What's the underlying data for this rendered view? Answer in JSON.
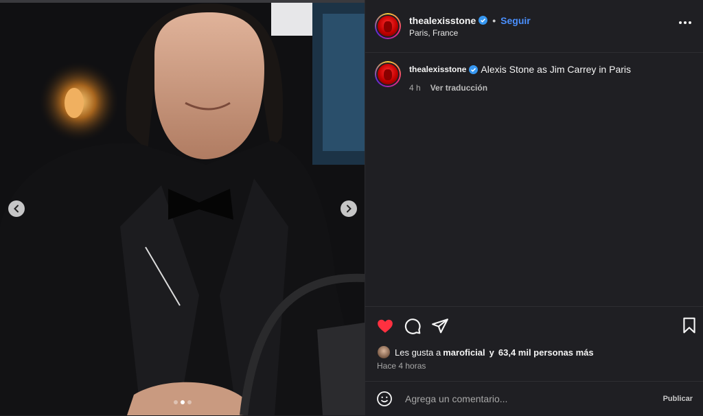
{
  "post": {
    "username": "thealexisstone",
    "separator": "•",
    "follow_label": "Seguir",
    "location": "Paris, France"
  },
  "caption": {
    "username": "thealexisstone",
    "text": "Alexis Stone as Jim Carrey in Paris",
    "time": "4 h",
    "translate_label": "Ver traducción"
  },
  "likes": {
    "prefix": "Les gusta a",
    "user": "maroficial",
    "conjunction": "y",
    "others": "63,4 mil personas más"
  },
  "timestamp": "Hace 4 horas",
  "comment": {
    "placeholder": "Agrega un comentario...",
    "publish_label": "Publicar"
  },
  "carousel": {
    "slide_count": 3,
    "active_slide": 2
  },
  "colors": {
    "background": "#1f1f23",
    "accent": "#4a90ff",
    "like": "#ff3040",
    "verified": "#3797f0"
  },
  "icons": [
    "chevron-left-icon",
    "chevron-right-icon",
    "verified-icon",
    "more-icon",
    "heart-icon",
    "comment-icon",
    "share-icon",
    "bookmark-icon",
    "emoji-icon"
  ]
}
